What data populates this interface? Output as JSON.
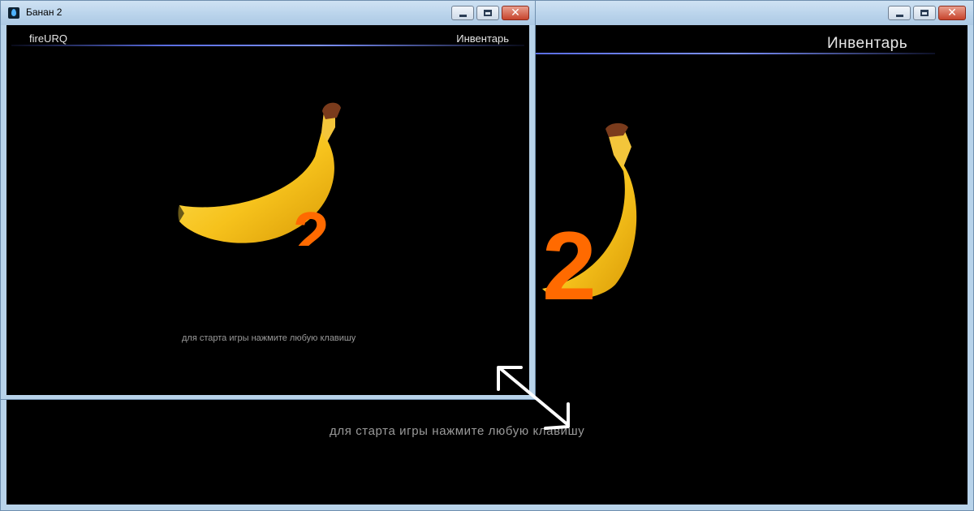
{
  "window": {
    "title": "Банан 2",
    "icon": "flame-app-icon",
    "controls": {
      "minimize": "minimize",
      "maximize": "maximize",
      "close": "✕"
    }
  },
  "game": {
    "engine_label": "fireURQ",
    "inventory_label": "Инвентарь",
    "logo_number": "2",
    "prompt": "для старта игры нажмите любую клавишу"
  },
  "colors": {
    "banana": "#f6c21c",
    "number": "#ff6a00",
    "frame": "#b8d3ea",
    "accent_line": "#6b7ff0",
    "text": "#e6e6e6",
    "prompt": "#9a9a9a"
  }
}
